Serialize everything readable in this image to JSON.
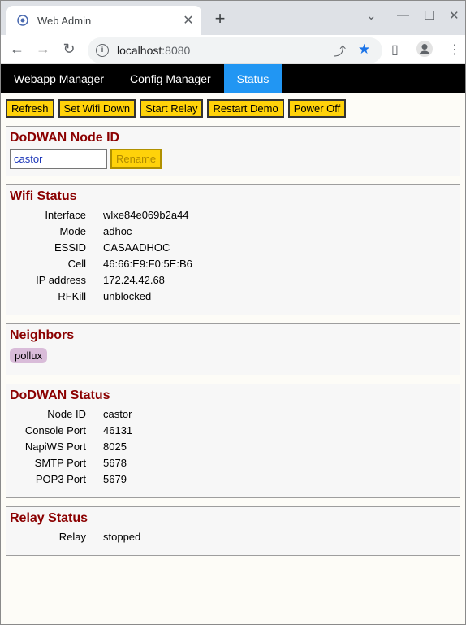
{
  "browser": {
    "tab_title": "Web Admin",
    "url_host": "localhost",
    "url_port": ":8080"
  },
  "nav": {
    "items": [
      {
        "label": "Webapp Manager"
      },
      {
        "label": "Config Manager"
      },
      {
        "label": "Status"
      }
    ],
    "active": "Status",
    "active_color": "#2196f3"
  },
  "actions": {
    "refresh": "Refresh",
    "set_wifi_down": "Set Wifi Down",
    "start_relay": "Start Relay",
    "restart_demo": "Restart Demo",
    "power_off": "Power Off"
  },
  "node_id": {
    "title": "DoDWAN Node ID",
    "value": "castor",
    "rename": "Rename"
  },
  "wifi": {
    "title": "Wifi Status",
    "rows": [
      {
        "key": "Interface",
        "value": "wlxe84e069b2a44"
      },
      {
        "key": "Mode",
        "value": "adhoc"
      },
      {
        "key": "ESSID",
        "value": "CASAADHOC"
      },
      {
        "key": "Cell",
        "value": "46:66:E9:F0:5E:B6"
      },
      {
        "key": "IP address",
        "value": "172.24.42.68"
      },
      {
        "key": "RFKill",
        "value": "unblocked"
      }
    ]
  },
  "neighbors": {
    "title": "Neighbors",
    "items": [
      "pollux"
    ]
  },
  "dodwan": {
    "title": "DoDWAN Status",
    "rows": [
      {
        "key": "Node ID",
        "value": "castor"
      },
      {
        "key": "Console Port",
        "value": "46131"
      },
      {
        "key": "NapiWS Port",
        "value": "8025"
      },
      {
        "key": "SMTP Port",
        "value": "5678"
      },
      {
        "key": "POP3 Port",
        "value": "5679"
      }
    ]
  },
  "relay": {
    "title": "Relay Status",
    "rows": [
      {
        "key": "Relay",
        "value": "stopped"
      }
    ]
  },
  "colors": {
    "heading": "#8b0000",
    "button": "#ffd20a",
    "chip": "#d9bcd9"
  }
}
